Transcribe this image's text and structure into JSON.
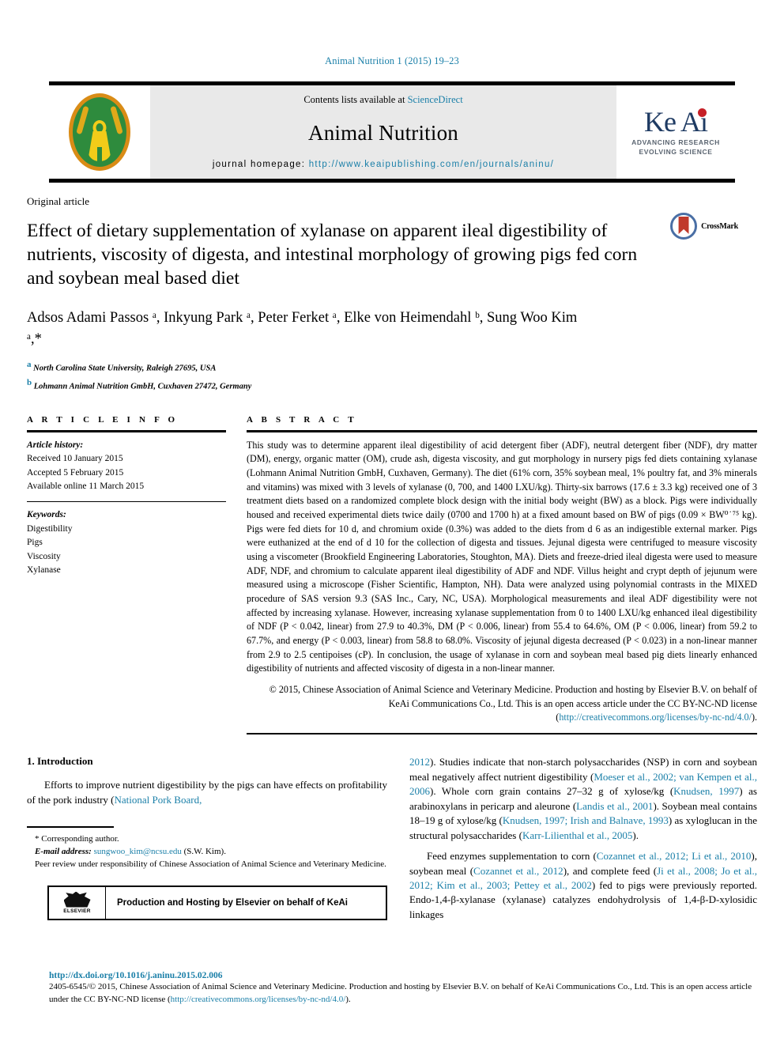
{
  "running_head": "Animal Nutrition 1 (2015) 19–23",
  "masthead": {
    "contents_prefix": "Contents lists available at ",
    "contents_link": "ScienceDirect",
    "journal_title": "Animal Nutrition",
    "homepage_label": "journal homepage: ",
    "homepage_url": "http://www.keaipublishing.com/en/journals/aninu/",
    "publisher_mark": "Ke Ai",
    "publisher_tagline_1": "ADVANCING RESEARCH",
    "publisher_tagline_2": "EVOLVING SCIENCE"
  },
  "title_block": {
    "article_type": "Original article",
    "title": "Effect of dietary supplementation of xylanase on apparent ileal digestibility of nutrients, viscosity of digesta, and intestinal morphology of growing pigs fed corn and soybean meal based diet",
    "crossmark_label": "CrossMark"
  },
  "authors": {
    "list": "Adsos Adami Passos ᵃ, Inkyung Park ᵃ, Peter Ferket ᵃ, Elke von Heimendahl ᵇ, Sung Woo Kim ᵃ,*",
    "affiliation_a": "North Carolina State University, Raleigh 27695, USA",
    "affiliation_b": "Lohmann Animal Nutrition GmbH, Cuxhaven 27472, Germany"
  },
  "article_info": {
    "heading": "A R T I C L E   I N F O",
    "history_label": "Article history:",
    "received": "Received 10 January 2015",
    "accepted": "Accepted 5 February 2015",
    "available": "Available online 11 March 2015",
    "keywords_label": "Keywords:",
    "keywords": [
      "Digestibility",
      "Pigs",
      "Viscosity",
      "Xylanase"
    ]
  },
  "abstract": {
    "heading": "A B S T R A C T",
    "text": "This study was to determine apparent ileal digestibility of acid detergent fiber (ADF), neutral detergent fiber (NDF), dry matter (DM), energy, organic matter (OM), crude ash, digesta viscosity, and gut morphology in nursery pigs fed diets containing xylanase (Lohmann Animal Nutrition GmbH, Cuxhaven, Germany). The diet (61% corn, 35% soybean meal, 1% poultry fat, and 3% minerals and vitamins) was mixed with 3 levels of xylanase (0, 700, and 1400 LXU/kg). Thirty-six barrows (17.6 ± 3.3 kg) received one of 3 treatment diets based on a randomized complete block design with the initial body weight (BW) as a block. Pigs were individually housed and received experimental diets twice daily (0700 and 1700 h) at a fixed amount based on BW of pigs (0.09 × BW⁰˙⁷⁵ kg). Pigs were fed diets for 10 d, and chromium oxide (0.3%) was added to the diets from d 6 as an indigestible external marker. Pigs were euthanized at the end of d 10 for the collection of digesta and tissues. Jejunal digesta were centrifuged to measure viscosity using a viscometer (Brookfield Engineering Laboratories, Stoughton, MA). Diets and freeze-dried ileal digesta were used to measure ADF, NDF, and chromium to calculate apparent ileal digestibility of ADF and NDF. Villus height and crypt depth of jejunum were measured using a microscope (Fisher Scientific, Hampton, NH). Data were analyzed using polynomial contrasts in the MIXED procedure of SAS version 9.3 (SAS Inc., Cary, NC, USA). Morphological measurements and ileal ADF digestibility were not affected by increasing xylanase. However, increasing xylanase supplementation from 0 to 1400 LXU/kg enhanced ileal digestibility of NDF (P < 0.042, linear) from 27.9 to 40.3%, DM (P < 0.006, linear) from 55.4 to 64.6%, OM (P < 0.006, linear) from 59.2 to 67.7%, and energy (P < 0.003, linear) from 58.8 to 68.0%. Viscosity of jejunal digesta decreased (P < 0.023) in a non-linear manner from 2.9 to 2.5 centipoises (cP). In conclusion, the usage of xylanase in corn and soybean meal based pig diets linearly enhanced digestibility of nutrients and affected viscosity of digesta in a non-linear manner.",
    "copyright_text": "© 2015, Chinese Association of Animal Science and Veterinary Medicine. Production and hosting by Elsevier B.V. on behalf of KeAi Communications Co., Ltd. This is an open access article under the CC BY-NC-ND license (",
    "copyright_link": "http://creativecommons.org/licenses/by-nc-nd/4.0/",
    "copyright_tail": ")."
  },
  "intro": {
    "heading": "1.  Introduction",
    "left_para_1_a": "Efforts to improve nutrient digestibility by the pigs can have effects on profitability of the pork industry (",
    "left_para_1_link": "National Pork Board,",
    "right_para_1_link_start": "2012",
    "right_para_1_a": "). Studies indicate that non-starch polysaccharides (NSP) in corn and soybean meal negatively affect nutrient digestibility (",
    "right_para_1_link_2": "Moeser et al., 2002; van Kempen et al., 2006",
    "right_para_1_b": "). Whole corn grain contains 27–32 g of xylose/kg (",
    "right_para_1_link_3": "Knudsen, 1997",
    "right_para_1_c": ") as arabinoxylans in pericarp and aleurone (",
    "right_para_1_link_4": "Landis et al., 2001",
    "right_para_1_d": "). Soybean meal contains 18–19 g of xylose/kg (",
    "right_para_1_link_5": "Knudsen, 1997; Irish and Balnave, 1993",
    "right_para_1_e": ") as xyloglucan in the structural polysaccharides (",
    "right_para_1_link_6": "Karr-Lilienthal et al., 2005",
    "right_para_1_f": ").",
    "right_para_2_a": "Feed enzymes supplementation to corn (",
    "right_para_2_link_1": "Cozannet et al., 2012; Li et al., 2010",
    "right_para_2_b": "), soybean meal (",
    "right_para_2_link_2": "Cozannet et al., 2012",
    "right_para_2_c": "), and complete feed (",
    "right_para_2_link_3": "Ji et al., 2008; Jo et al., 2012; Kim et al., 2003; Pettey et al., 2002",
    "right_para_2_d": ") fed to pigs were previously reported. Endo-1,4-β-xylanase (xylanase) catalyzes endohydrolysis of 1,4-β-D-xylosidic linkages"
  },
  "footnote": {
    "corresponding": "Corresponding author.",
    "email_label": "E-mail address:",
    "email": "sungwoo_kim@ncsu.edu",
    "email_owner": "(S.W. Kim).",
    "peer_review": "Peer review under responsibility of Chinese Association of Animal Science and Veterinary Medicine.",
    "elsevier_banner": "Production and Hosting by Elsevier on behalf of KeAi",
    "elsevier_name": "ELSEVIER"
  },
  "footer": {
    "doi": "http://dx.doi.org/10.1016/j.aninu.2015.02.006",
    "copy_a": "2405-6545/© 2015, Chinese Association of Animal Science and Veterinary Medicine. Production and hosting by Elsevier B.V. on behalf of KeAi Communications Co., Ltd. This is an open access article under the CC BY-NC-ND license (",
    "copy_link": "http://creativecommons.org/licenses/by-nc-nd/4.0/",
    "copy_tail": ")."
  },
  "colors": {
    "link": "#1a7fa8",
    "keai_navy": "#1f3b63",
    "keai_dot_red": "#c62027",
    "logo_green": "#2e8b3d",
    "logo_gold": "#d98c16"
  }
}
